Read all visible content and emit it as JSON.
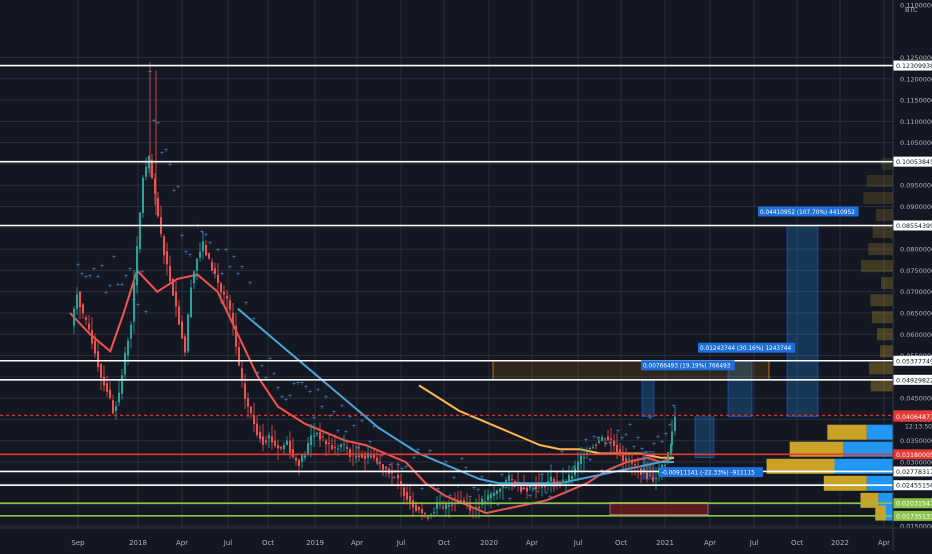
{
  "chart_data": {
    "type": "candlestick",
    "title": "",
    "ylabel": "BTC",
    "ylim": [
      0.0145,
      0.1385
    ],
    "x_ticks": [
      "Sep",
      "2018",
      "Apr",
      "Jul",
      "Oct",
      "2019",
      "Apr",
      "Jul",
      "Oct",
      "2020",
      "Apr",
      "Jul",
      "Oct",
      "2021",
      "Apr",
      "Jul",
      "Oct",
      "2022",
      "Apr"
    ],
    "y_ticks": [
      "0.1100000",
      "0.1250000",
      "0.1200000",
      "0.1150000",
      "0.1100000",
      "0.1050000",
      "0.1000000",
      "0.0950000",
      "0.0900000",
      "0.0850000",
      "0.0800000",
      "0.0750000",
      "0.0700000",
      "0.0650000",
      "0.0600000",
      "0.0550000",
      "0.0500000",
      "0.0450000",
      "0.0400000",
      "0.0350000",
      "0.0300000",
      "0.0250000",
      "0.0200000",
      "0.0150000"
    ],
    "horizontal_levels": [
      {
        "label": "0.12309938",
        "value": 0.12309938,
        "color": "#ffffff"
      },
      {
        "label": "0.10053845",
        "value": 0.10053845,
        "color": "#ffffff"
      },
      {
        "label": "0.08554399",
        "value": 0.08554399,
        "color": "#ffffff"
      },
      {
        "label": "0.05377749",
        "value": 0.05377749,
        "color": "#ffffff"
      },
      {
        "label": "0.04929822",
        "value": 0.04929822,
        "color": "#ffffff"
      },
      {
        "label": "0.04096303",
        "value": 0.04096303,
        "color": "#e53935"
      },
      {
        "label": "0.03180005",
        "value": 0.03180005,
        "color": "#e53935"
      },
      {
        "label": "0.02778317",
        "value": 0.02778317,
        "color": "#ffffff"
      },
      {
        "label": "0.02455156",
        "value": 0.02455156,
        "color": "#ffffff"
      },
      {
        "label": "0.02031547",
        "value": 0.02031547,
        "color": "#8bc34a"
      },
      {
        "label": "0.01735131",
        "value": 0.01735131,
        "color": "#8bc34a"
      }
    ],
    "price_tag": {
      "value": 0.04064873,
      "label": "0.04064873",
      "countdown": "12:13:50"
    },
    "measure_labels": [
      "0.00766493 (19.19%) 766493",
      "0.01243744 (30.16%) 1243744",
      "0.04410952 (107.70%) 4410952",
      "-0.00911141 (-22.33%) -911115"
    ],
    "series": [
      {
        "name": "",
        "color": "#ef5350",
        "type": "moving-average",
        "points": [
          [
            0,
            0.065
          ],
          [
            0.03,
            0.06
          ],
          [
            0.06,
            0.056
          ],
          [
            0.08,
            0.065
          ],
          [
            0.1,
            0.075
          ],
          [
            0.13,
            0.07
          ],
          [
            0.16,
            0.073
          ],
          [
            0.19,
            0.074
          ],
          [
            0.22,
            0.07
          ],
          [
            0.25,
            0.06
          ],
          [
            0.28,
            0.05
          ],
          [
            0.31,
            0.043
          ],
          [
            0.35,
            0.039
          ],
          [
            0.38,
            0.037
          ],
          [
            0.41,
            0.035
          ],
          [
            0.44,
            0.034
          ],
          [
            0.47,
            0.032
          ],
          [
            0.5,
            0.03
          ],
          [
            0.53,
            0.025
          ],
          [
            0.56,
            0.022
          ],
          [
            0.59,
            0.02
          ],
          [
            0.62,
            0.018
          ],
          [
            0.65,
            0.019
          ],
          [
            0.68,
            0.02
          ],
          [
            0.71,
            0.021
          ],
          [
            0.74,
            0.023
          ],
          [
            0.77,
            0.025
          ],
          [
            0.8,
            0.028
          ],
          [
            0.83,
            0.03
          ],
          [
            0.86,
            0.031
          ],
          [
            0.88,
            0.03
          ],
          [
            0.9,
            0.031
          ]
        ]
      },
      {
        "name": "",
        "color": "#4ba3d6",
        "type": "moving-average",
        "points": [
          [
            0.25,
            0.066
          ],
          [
            0.28,
            0.062
          ],
          [
            0.31,
            0.058
          ],
          [
            0.34,
            0.054
          ],
          [
            0.37,
            0.05
          ],
          [
            0.4,
            0.046
          ],
          [
            0.43,
            0.042
          ],
          [
            0.46,
            0.038
          ],
          [
            0.49,
            0.035
          ],
          [
            0.52,
            0.032
          ],
          [
            0.55,
            0.03
          ],
          [
            0.58,
            0.028
          ],
          [
            0.61,
            0.026
          ],
          [
            0.64,
            0.025
          ],
          [
            0.67,
            0.025
          ],
          [
            0.7,
            0.025
          ],
          [
            0.73,
            0.025
          ],
          [
            0.76,
            0.026
          ],
          [
            0.79,
            0.027
          ],
          [
            0.82,
            0.028
          ],
          [
            0.85,
            0.029
          ],
          [
            0.88,
            0.03
          ],
          [
            0.9,
            0.03
          ]
        ]
      },
      {
        "name": "",
        "color": "#ffb74d",
        "type": "moving-average",
        "points": [
          [
            0.52,
            0.048
          ],
          [
            0.55,
            0.045
          ],
          [
            0.58,
            0.042
          ],
          [
            0.61,
            0.04
          ],
          [
            0.64,
            0.038
          ],
          [
            0.67,
            0.036
          ],
          [
            0.7,
            0.034
          ],
          [
            0.73,
            0.033
          ],
          [
            0.76,
            0.033
          ],
          [
            0.79,
            0.032
          ],
          [
            0.82,
            0.032
          ],
          [
            0.85,
            0.032
          ],
          [
            0.88,
            0.031
          ],
          [
            0.9,
            0.031
          ]
        ]
      }
    ],
    "volume_profile": [
      {
        "price": 0.037,
        "gold": 0.55,
        "blue": 0.45
      },
      {
        "price": 0.033,
        "gold": 0.75,
        "blue": 0.85
      },
      {
        "price": 0.029,
        "gold": 0.95,
        "blue": 1.0
      },
      {
        "price": 0.025,
        "gold": 0.6,
        "blue": 0.45
      },
      {
        "price": 0.021,
        "gold": 0.25,
        "blue": 0.25
      },
      {
        "price": 0.018,
        "gold": 0.15,
        "blue": 0.12
      }
    ],
    "grid": true,
    "legend": "none"
  }
}
